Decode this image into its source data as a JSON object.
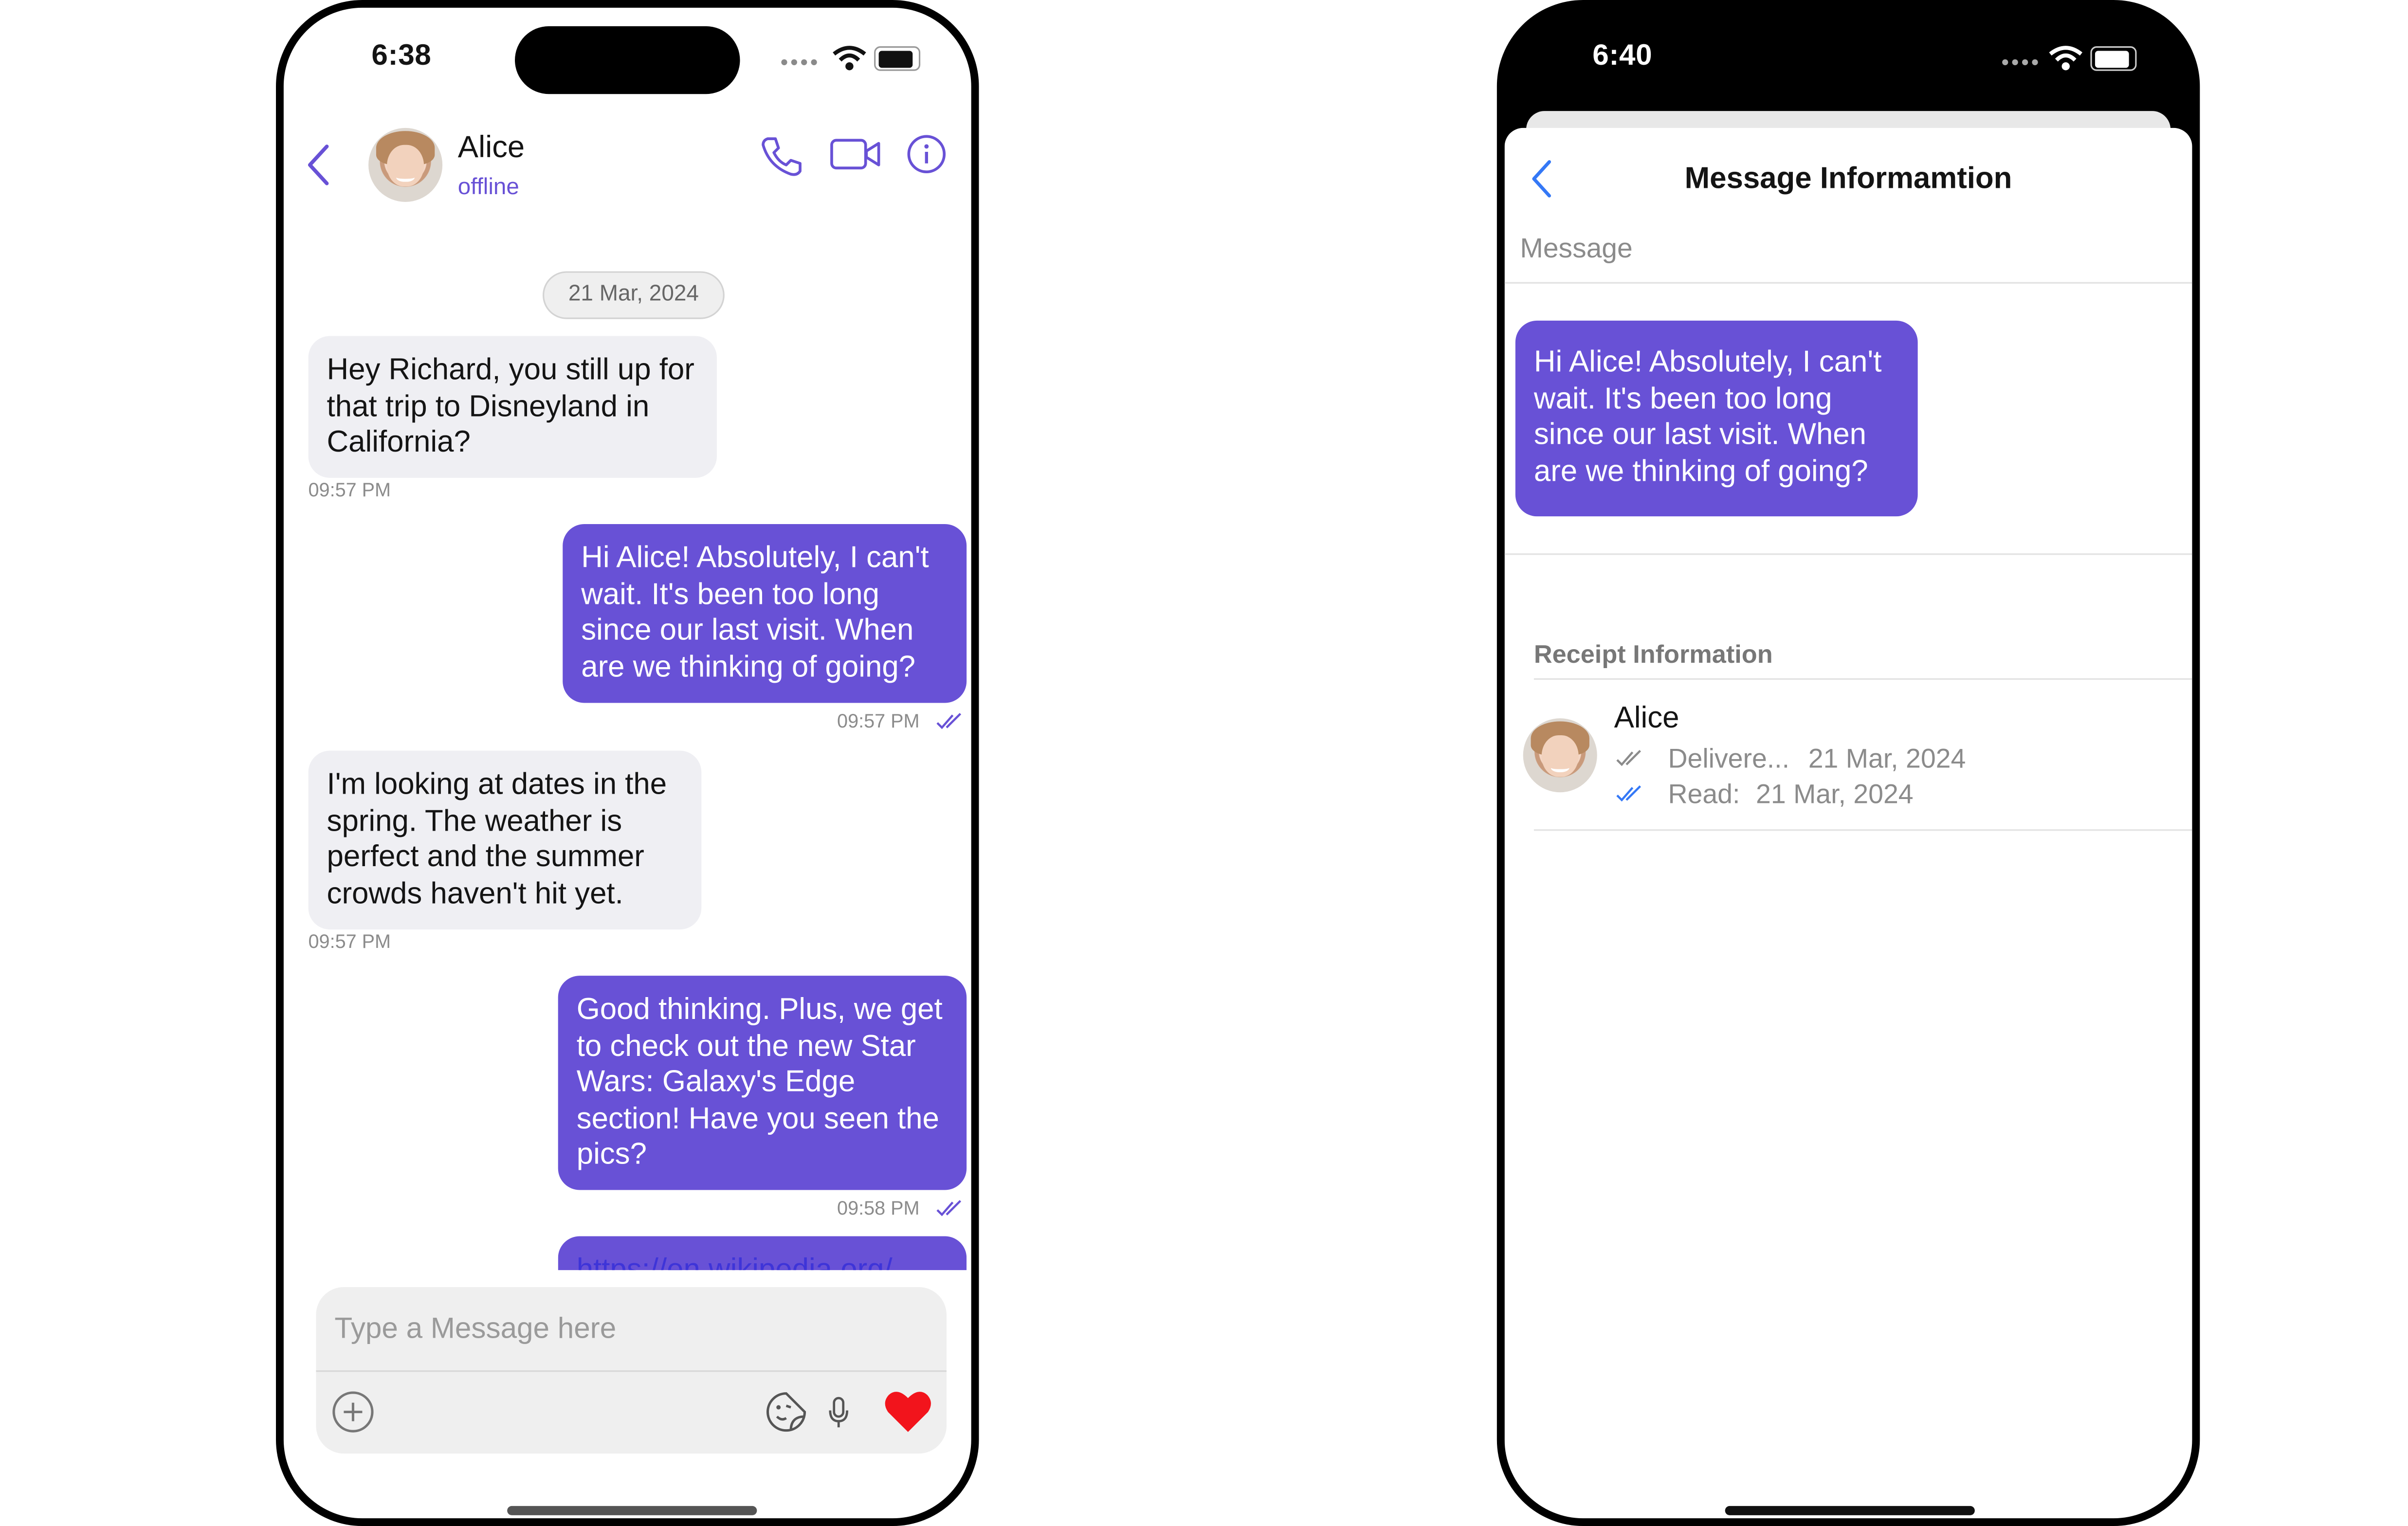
{
  "phone1": {
    "status": {
      "time": "6:38"
    },
    "header": {
      "name": "Alice",
      "status": "offline"
    },
    "date_separator": "21 Mar, 2024",
    "messages": [
      {
        "direction": "incoming",
        "lines": [
          "Hey Richard, you still up for",
          "that trip to Disneyland in",
          "California?"
        ],
        "time": "09:57 PM"
      },
      {
        "direction": "outgoing",
        "lines": [
          "Hi Alice! Absolutely, I can't",
          "wait. It's been too long",
          "since our last visit. When",
          "are we thinking of going?"
        ],
        "time": "09:57 PM"
      },
      {
        "direction": "incoming",
        "lines": [
          "I'm looking at dates in the",
          "spring. The weather is",
          "perfect and the summer",
          "crowds haven't hit yet."
        ],
        "time": "09:57 PM"
      },
      {
        "direction": "outgoing",
        "lines": [
          "Good thinking. Plus, we get",
          "to check out the new Star",
          "Wars: Galaxy's Edge",
          "section! Have you seen the",
          "pics?"
        ],
        "time": "09:58 PM"
      },
      {
        "direction": "outgoing",
        "link": "https://en.wikipedia.org/"
      }
    ],
    "composer": {
      "placeholder": "Type a Message here"
    },
    "icons": [
      "back-chevron-icon",
      "phone-icon",
      "video-icon",
      "info-icon",
      "plus-icon",
      "sticker-icon",
      "mic-icon",
      "heart-icon"
    ],
    "colors": {
      "accent": "#6851d6",
      "incoming_bubble": "#efeff3",
      "heart": "#f2141c"
    }
  },
  "phone2": {
    "status": {
      "time": "6:40"
    },
    "title": "Message Informamtion",
    "section_message": "Message",
    "message_lines": [
      "Hi Alice! Absolutely, I can't",
      "wait. It's been too long",
      "since our last visit. When",
      "are we thinking of going?"
    ],
    "section_receipt": "Receipt Information",
    "receipt": {
      "name": "Alice",
      "delivered_label": "Delivere...",
      "delivered_date": "21 Mar, 2024",
      "read_label": "Read:",
      "read_date": "21 Mar, 2024"
    },
    "colors": {
      "link": "#3478f6",
      "delivered_tick": "#8b8b8b",
      "read_tick": "#3478f6"
    }
  }
}
